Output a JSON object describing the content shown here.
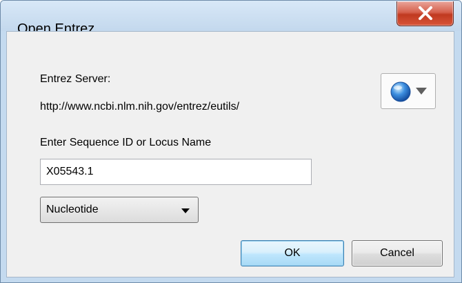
{
  "window": {
    "title": "Open Entrez",
    "close_icon": "close-x-icon"
  },
  "server": {
    "label": "Entrez Server:",
    "url": "http://www.ncbi.nlm.nih.gov/entrez/eutils/",
    "button_icon": "globe-icon"
  },
  "sequence": {
    "label": "Enter Sequence ID or Locus Name",
    "value": "X05543.1"
  },
  "database": {
    "selected": "Nucleotide"
  },
  "buttons": {
    "ok": "OK",
    "cancel": "Cancel"
  },
  "colors": {
    "title_bar": "#c4daef",
    "close_button": "#c8442b",
    "dialog_body": "#f0f0f0",
    "default_button": "#bee6fd"
  }
}
